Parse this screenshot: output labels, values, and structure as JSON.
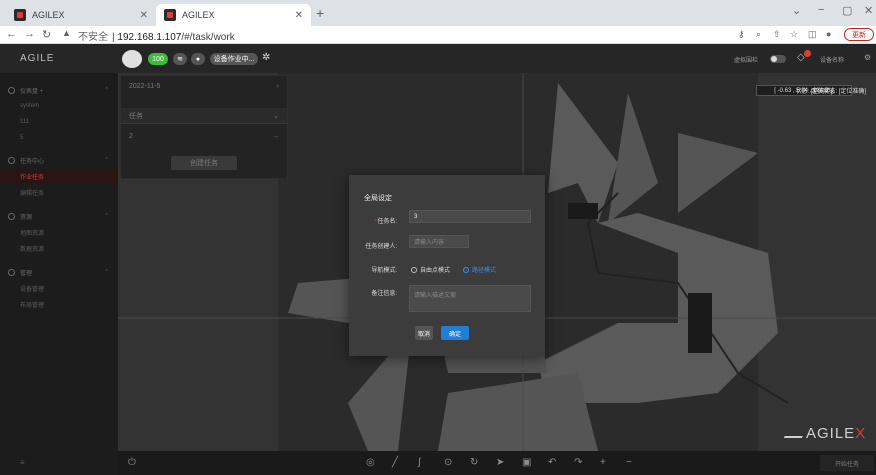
{
  "browser": {
    "tabs": [
      {
        "title": "AGILEX",
        "active": false
      },
      {
        "title": "AGILEX",
        "active": true
      }
    ],
    "address": {
      "security": "不安全",
      "host": "192.168.1.107",
      "path": "/#/task/work"
    },
    "update_label": "更新"
  },
  "topbar": {
    "logo": "AGILE",
    "battery": "100",
    "status_pill": "设备作业中...",
    "virtual_wall": "虚拟围栏",
    "device_name": "设备名称"
  },
  "sidebar": {
    "groups": [
      {
        "label": "仪表盘 +",
        "items": [
          "system",
          "111",
          "5"
        ]
      },
      {
        "label": "任务中心",
        "items": [
          "作业任务",
          "编辑任务"
        ]
      },
      {
        "label": "资源",
        "items": [
          "地图资源",
          "数据资源"
        ]
      },
      {
        "label": "管理",
        "items": [
          "设备管理",
          "布局管理"
        ]
      }
    ],
    "active_item": "作业任务",
    "footer": "≡"
  },
  "task_panel": {
    "date": "2022-11-5",
    "selected": "任务",
    "second": "2",
    "create_label": "创建任务"
  },
  "status_bar": {
    "coords": "[ -0.63 , 5.84 , 124.9° ]",
    "state": "状态: [空闲中]",
    "loc_state": "定位状态: [定位准确]"
  },
  "dialog": {
    "title": "全局设定",
    "task_name_label": "任务名:",
    "task_name_value": "3",
    "creator_label": "任务创建人:",
    "creator_placeholder": "请输入内容",
    "nav_mode_label": "导航模式:",
    "nav_modes": [
      "自由点模式",
      "路径模式"
    ],
    "nav_mode_selected": "路径模式",
    "notes_label": "备注信息:",
    "notes_placeholder": "请输入描述文案",
    "cancel_label": "取消",
    "ok_label": "确定"
  },
  "brand": {
    "text": "AGILE",
    "x": "X"
  },
  "bottom": {
    "start_label": "开始任务"
  },
  "colors": {
    "accent": "#1f7ed8",
    "danger": "#e53935",
    "active_nav": "#c14040"
  }
}
